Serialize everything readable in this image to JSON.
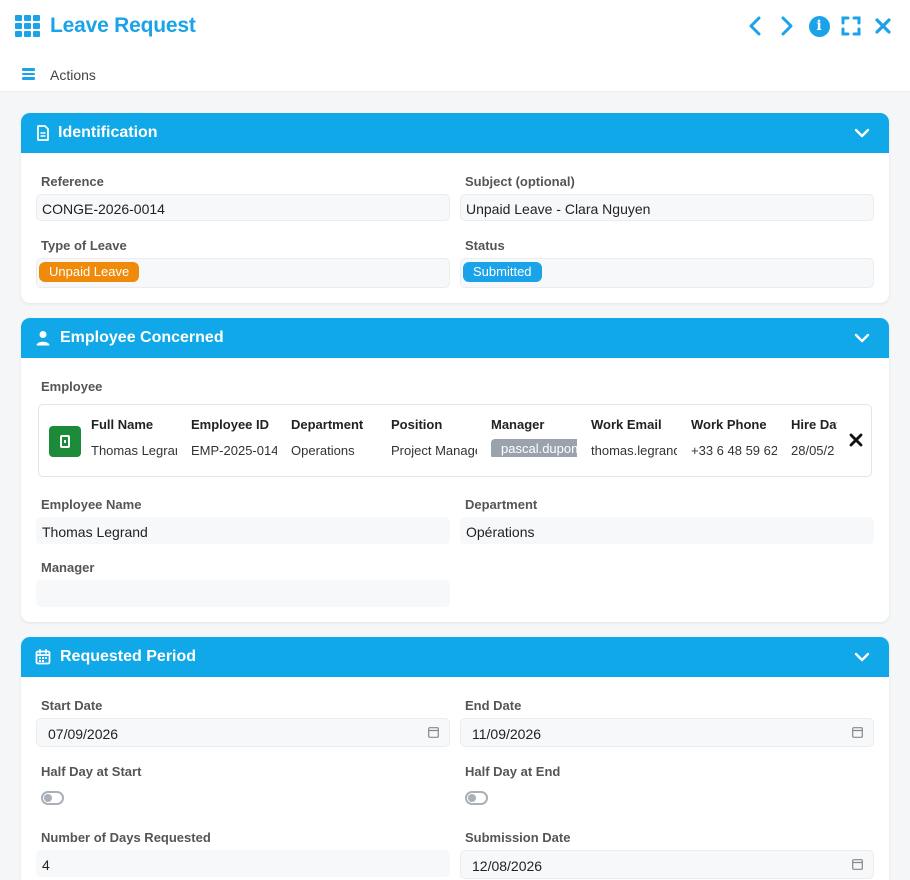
{
  "header": {
    "title": "Leave Request",
    "icons": [
      "apps-grid-icon",
      "chevron-left-icon",
      "chevron-right-icon",
      "info-icon",
      "fullscreen-icon",
      "close-icon"
    ]
  },
  "actions": {
    "label": "Actions"
  },
  "colors": {
    "accent": "#10a8e8",
    "unpaid_badge": "#f08a0a",
    "status_badge": "#1aa3e8",
    "employee_avatar": "#1b8b3a"
  },
  "identification": {
    "title": "Identification",
    "reference_label": "Reference",
    "reference_value": "CONGE-2026-0014",
    "subject_label": "Subject (optional)",
    "subject_value": "Unpaid Leave - Clara Nguyen",
    "type_label": "Type of Leave",
    "type_value": "Unpaid Leave",
    "status_label": "Status",
    "status_value": "Submitted"
  },
  "employee": {
    "title": "Employee Concerned",
    "employee_label": "Employee",
    "card": {
      "columns": [
        {
          "header": "Full Name",
          "value": "Thomas Legrand"
        },
        {
          "header": "Employee ID",
          "value": "EMP-2025-014"
        },
        {
          "header": "Department",
          "value": "Operations"
        },
        {
          "header": "Position",
          "value": "Project Manager"
        },
        {
          "header": "Manager",
          "value": "pascal.dupont"
        },
        {
          "header": "Work Email",
          "value": "thomas.legrand"
        },
        {
          "header": "Work Phone",
          "value": "+33 6 48 59 62"
        },
        {
          "header": "Hire Date",
          "value": "28/05/2"
        }
      ]
    },
    "name_label": "Employee Name",
    "name_value": "Thomas Legrand",
    "department_label": "Department",
    "department_value": "Opérations",
    "manager_label": "Manager",
    "manager_value": ""
  },
  "period": {
    "title": "Requested Period",
    "start_label": "Start Date",
    "start_value": "07/09/2026",
    "end_label": "End Date",
    "end_value": "11/09/2026",
    "half_start_label": "Half Day at Start",
    "half_end_label": "Half Day at End",
    "days_label": "Number of Days Requested",
    "days_value": "4",
    "submission_label": "Submission Date",
    "submission_value": "12/08/2026"
  }
}
